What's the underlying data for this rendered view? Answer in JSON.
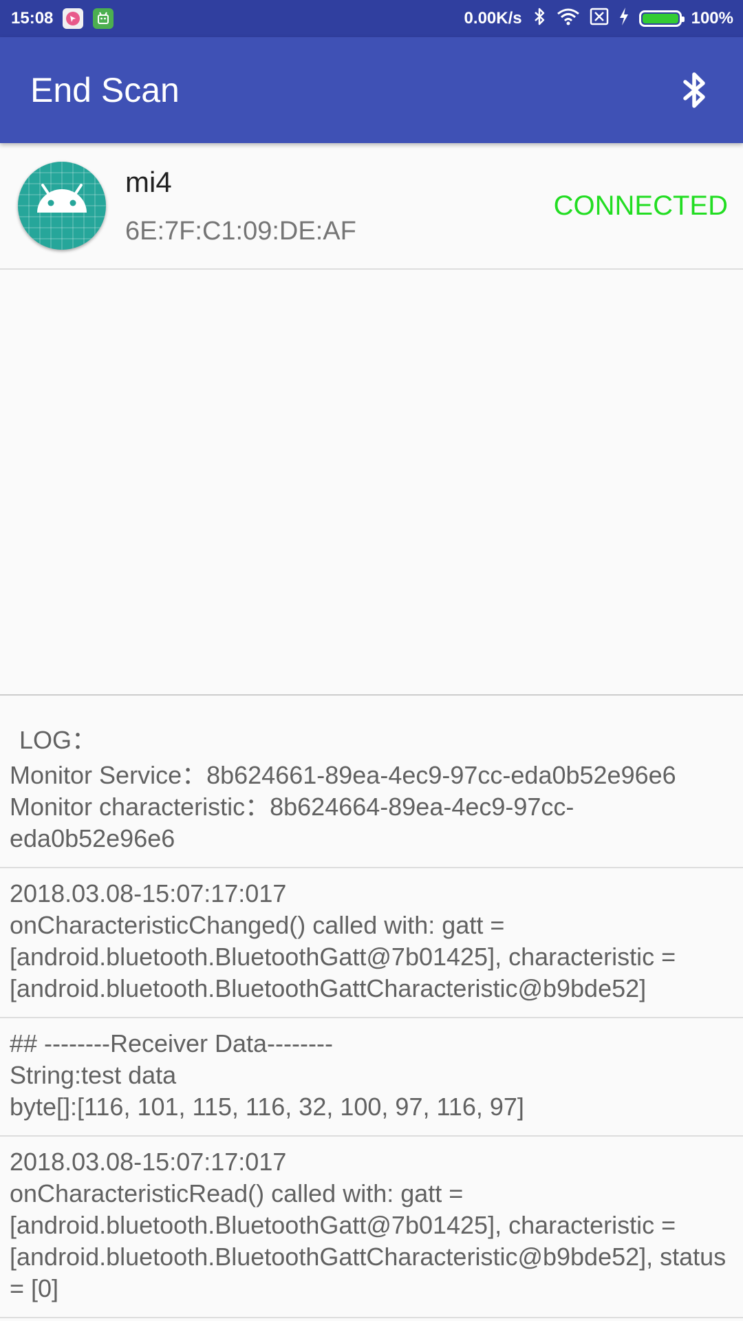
{
  "status_bar": {
    "time": "15:08",
    "network_speed": "0.00K/s",
    "battery_level": 100,
    "battery_text": "100%",
    "battery_color": "#33cc33",
    "icons": [
      "bluetooth-icon",
      "wifi-icon",
      "no-sim-icon",
      "charging-icon"
    ]
  },
  "app_bar": {
    "title": "End Scan",
    "action_icon": "bluetooth-icon",
    "color": "#3f51b5"
  },
  "device": {
    "name": "mi4",
    "address": "6E:7F:C1:09:DE:AF",
    "status": "CONNECTED",
    "status_color": "#22dd22",
    "avatar_icon": "android-icon"
  },
  "log": {
    "label": "LOG：",
    "entries": [
      "Monitor Service：8b624661-89ea-4ec9-97cc-eda0b52e96e6\nMonitor characteristic：8b624664-89ea-4ec9-97cc-eda0b52e96e6",
      "2018.03.08-15:07:17:017\nonCharacteristicChanged() called with: gatt = [android.bluetooth.BluetoothGatt@7b01425], characteristic = [android.bluetooth.BluetoothGattCharacteristic@b9bde52]",
      "## --------Receiver Data--------\nString:test data\nbyte[]:[116, 101, 115, 116, 32, 100, 97, 116, 97]",
      "2018.03.08-15:07:17:017\nonCharacteristicRead() called with: gatt = [android.bluetooth.BluetoothGatt@7b01425], characteristic = [android.bluetooth.BluetoothGattCharacteristic@b9bde52], status = [0]"
    ]
  }
}
